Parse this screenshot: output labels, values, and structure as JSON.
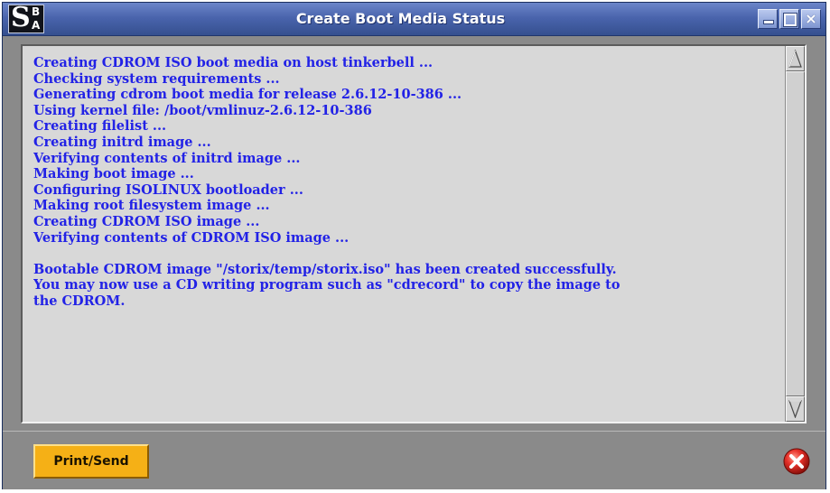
{
  "window": {
    "title": "Create Boot Media Status",
    "logo_letters": {
      "main": "S",
      "top": "B",
      "bottom": "A"
    },
    "minimize_icon": "minimize-icon",
    "maximize_icon": "maximize-icon",
    "close_icon": "close-icon",
    "close_glyph": "×"
  },
  "log": {
    "lines": [
      "Creating CDROM ISO boot media on host tinkerbell ...",
      "Checking system requirements ...",
      "Generating cdrom boot media for release 2.6.12-10-386 ...",
      "Using kernel file: /boot/vmlinuz-2.6.12-10-386",
      "Creating filelist ...",
      "Creating initrd image ...",
      "Verifying contents of initrd image ...",
      "Making boot image ...",
      "Configuring ISOLINUX bootloader ...",
      "Making root filesystem image ...",
      "Creating CDROM ISO image ...",
      "Verifying contents of CDROM ISO image ...",
      "",
      "Bootable CDROM image \"/storix/temp/storix.iso\" has been created successfully.",
      "You may now use a CD writing program such as \"cdrecord\" to copy the image to",
      "the CDROM."
    ],
    "text_color": "#2222e6"
  },
  "scrollbar": {
    "up_icon": "scroll-up-arrow-icon",
    "down_icon": "scroll-down-arrow-icon"
  },
  "footer": {
    "print_send_label": "Print/Send",
    "cancel_icon": "cancel-icon",
    "accent_color": "#f5b016",
    "cancel_color": "#e8322a"
  }
}
